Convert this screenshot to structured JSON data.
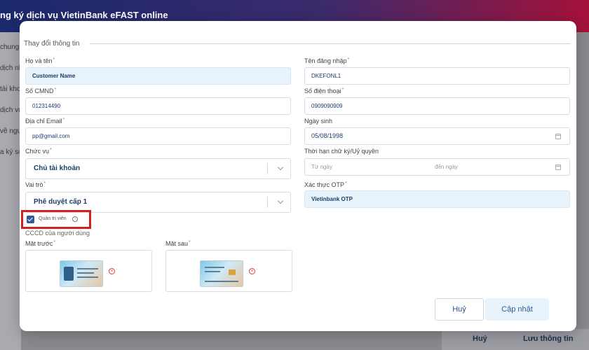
{
  "background": {
    "header_title": "ng ký dịch vụ VietinBank eFAST online",
    "side_items": [
      "chung",
      "dịch nhà",
      "tài khoả",
      "dịch vụ",
      "về người",
      "a ký số"
    ],
    "footer": {
      "cancel_label": "Huỷ",
      "save_label": "Lưu thông tin"
    }
  },
  "modal": {
    "section_title": "Thay đổi thông tin",
    "fields": {
      "full_name": {
        "label": "Họ và tên",
        "value": "Customer Name"
      },
      "username": {
        "label": "Tên đăng nhập",
        "value": "DKEFONL1"
      },
      "id_number": {
        "label": "Số CMND",
        "value": "012314490"
      },
      "phone": {
        "label": "Số điện thoại",
        "value": "0909090909"
      },
      "email": {
        "label": "Địa chỉ Email",
        "value": "pp@gmail.com"
      },
      "birthday": {
        "label": "Ngày sinh",
        "value": "05/08/1998"
      },
      "position": {
        "label": "Chức vụ",
        "value": "Chủ tài khoản"
      },
      "signature_period": {
        "label": "Thời hạn chữ ký/Uỷ quyền",
        "from_placeholder": "Từ ngày",
        "to_placeholder": "đến ngày"
      },
      "role": {
        "label": "Vai trò",
        "value": "Phê duyệt cấp 1"
      },
      "otp": {
        "label": "Xác thực OTP",
        "value": "Vietinbank OTP"
      }
    },
    "admin_checkbox": {
      "label": "Quản trị viên",
      "checked": true,
      "info_glyph": "i"
    },
    "cccd": {
      "label": "CCCD của người dùng",
      "front_label": "Mặt trước",
      "back_label": "Mặt sau",
      "remove_glyph": "×"
    },
    "buttons": {
      "cancel": "Huỷ",
      "update": "Cập nhật"
    },
    "required_mark": "*"
  }
}
